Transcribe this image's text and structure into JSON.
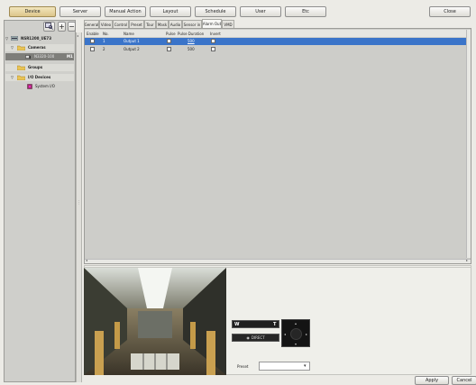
{
  "top_nav": {
    "device": "Device",
    "server": "Server",
    "manual_action": "Manual Action",
    "layout": "Layout",
    "schedule": "Schedule",
    "user": "User",
    "etc": "Etc",
    "close": "Close"
  },
  "tree": {
    "root": "NSR1200_UE73",
    "cameras": "Cameras",
    "camera_item": "N3320-100",
    "camera_badge": "M1",
    "groups": "Groups",
    "io_devices": "I/O Devices",
    "system_io": "System I/O"
  },
  "tabs": [
    "General",
    "Video",
    "Control",
    "Preset",
    "Tour",
    "Mask",
    "Audio",
    "Sensor in",
    "Alarm Out",
    "VMD"
  ],
  "table": {
    "headers": [
      "Enable",
      "No.",
      "Name",
      "Pulse",
      "Pulse Duration",
      "Invert"
    ],
    "rows": [
      {
        "no": "1",
        "name": "Output 1",
        "duration": "500",
        "selected": true
      },
      {
        "no": "2",
        "name": "Output 2",
        "duration": "500",
        "selected": false
      }
    ]
  },
  "ptz": {
    "zoom_w": "W",
    "zoom_t": "T",
    "direct_label": "DIRECT",
    "preset_label": "Preset",
    "preset_value": ""
  },
  "footer": {
    "apply": "Apply",
    "cancel": "Cancel"
  },
  "colors": {
    "selection": "#3a74c9",
    "accent_button": "#dcc58a"
  }
}
